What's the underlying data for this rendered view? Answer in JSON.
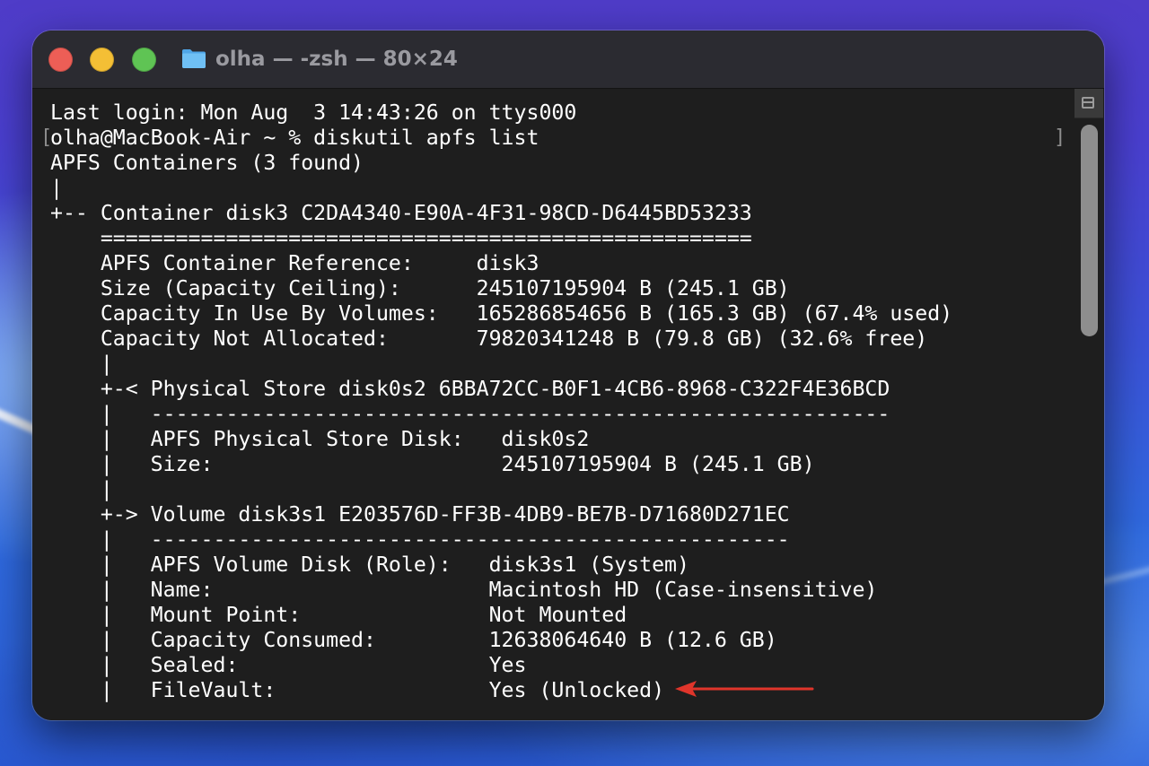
{
  "window": {
    "title": "olha — -zsh — 80×24",
    "folder_icon": "folder-icon",
    "buttons": {
      "close_icon": "close-icon",
      "minimize_icon": "minimize-icon",
      "maximize_icon": "maximize-icon"
    }
  },
  "terminal": {
    "lines": [
      "Last login: Mon Aug  3 14:43:26 on ttys000",
      "olha@MacBook-Air ~ % diskutil apfs list",
      "APFS Containers (3 found)",
      "|",
      "+-- Container disk3 C2DA4340-E90A-4F31-98CD-D6445BD53233",
      "    ====================================================",
      "    APFS Container Reference:     disk3",
      "    Size (Capacity Ceiling):      245107195904 B (245.1 GB)",
      "    Capacity In Use By Volumes:   165286854656 B (165.3 GB) (67.4% used)",
      "    Capacity Not Allocated:       79820341248 B (79.8 GB) (32.6% free)",
      "    |",
      "    +-< Physical Store disk0s2 6BBA72CC-B0F1-4CB6-8968-C322F4E36BCD",
      "    |   -----------------------------------------------------------",
      "    |   APFS Physical Store Disk:   disk0s2",
      "    |   Size:                       245107195904 B (245.1 GB)",
      "    |",
      "    +-> Volume disk3s1 E203576D-FF3B-4DB9-BE7B-D71680D271EC",
      "    |   ---------------------------------------------------",
      "    |   APFS Volume Disk (Role):   disk3s1 (System)",
      "    |   Name:                      Macintosh HD (Case-insensitive)",
      "    |   Mount Point:               Not Mounted",
      "    |   Capacity Consumed:         12638064640 B (12.6 GB)",
      "    |   Sealed:                    Yes",
      "    |   FileVault:                 Yes (Unlocked)"
    ],
    "prompt_bracket_left": "[",
    "prompt_bracket_right": "]"
  },
  "scrollbar": {
    "toggle_icon": "scrollback-marks-icon",
    "thumb_fraction": 0.35
  },
  "annotation": {
    "arrow_icon": "red-arrow-icon",
    "color": "#e0352b"
  },
  "colors": {
    "terminal_bg": "#1e1e1e",
    "titlebar_bg": "#2b2b31",
    "text": "#ffffff",
    "title_text": "#9a9aa0",
    "close": "#ed5e56",
    "minimize": "#f4bf35",
    "maximize": "#5fc454"
  }
}
